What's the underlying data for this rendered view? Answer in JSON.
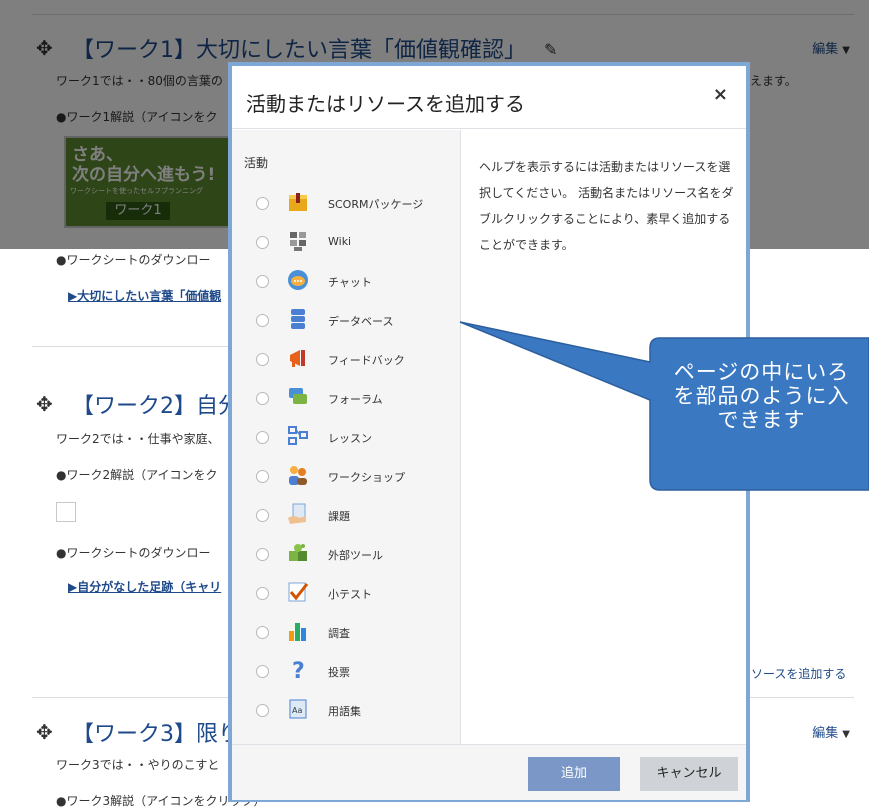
{
  "sections": [
    {
      "title": "【ワーク1】大切にしたい言葉「価値観確認」",
      "edit_label": "編集",
      "intro": "ワーク1では・・80個の言葉の",
      "intro_tail": "えます。",
      "explain": "●ワーク1解説（アイコンをク",
      "download": "●ワークシートのダウンロー",
      "link": "▶大切にしたい言葉「価値観"
    },
    {
      "title": "【ワーク2】自分",
      "intro": "ワーク2では・・仕事や家庭、",
      "explain": "●ワーク2解説（アイコンをク",
      "download": "●ワークシートのダウンロー",
      "link": "▶自分がなした足跡（キャリ"
    },
    {
      "title": "【ワーク3】限り",
      "edit_label": "編集",
      "intro": "ワーク3では・・やりのこすと",
      "explain": "●ワーク3解説（アイコンをクリック）"
    }
  ],
  "banner": {
    "line1": "さあ、",
    "line2": "次の自分へ進もう!",
    "line3": "ワークシートを使ったセルフプランニング",
    "button": "ワーク1"
  },
  "add_resource_link": "リソースを追加する",
  "modal": {
    "title": "活動またはリソースを追加する",
    "close": "×",
    "category_label": "活動",
    "options": [
      {
        "label": "SCORMパッケージ",
        "icon": "scorm-package-icon"
      },
      {
        "label": "Wiki",
        "icon": "wiki-icon"
      },
      {
        "label": "チャット",
        "icon": "chat-icon"
      },
      {
        "label": "データベース",
        "icon": "database-icon"
      },
      {
        "label": "フィードバック",
        "icon": "feedback-megaphone-icon"
      },
      {
        "label": "フォーラム",
        "icon": "forum-icon"
      },
      {
        "label": "レッスン",
        "icon": "lesson-icon"
      },
      {
        "label": "ワークショップ",
        "icon": "workshop-icon"
      },
      {
        "label": "課題",
        "icon": "assignment-icon"
      },
      {
        "label": "外部ツール",
        "icon": "external-tool-puzzle-icon"
      },
      {
        "label": "小テスト",
        "icon": "quiz-check-icon"
      },
      {
        "label": "調査",
        "icon": "survey-chart-icon"
      },
      {
        "label": "投票",
        "icon": "choice-question-icon"
      },
      {
        "label": "用語集",
        "icon": "glossary-icon"
      }
    ],
    "help": "ヘルプを表示するには活動またはリソースを選択してください。 活動名またはリソース名をダブルクリックすることにより、素早く追加することができます。",
    "add_button": "追加",
    "cancel_button": "キャンセル"
  },
  "callout": {
    "line1": "ページの中にいろ",
    "line2": "を部品のように入",
    "line3": "できます",
    "color": "#3b78c2"
  }
}
